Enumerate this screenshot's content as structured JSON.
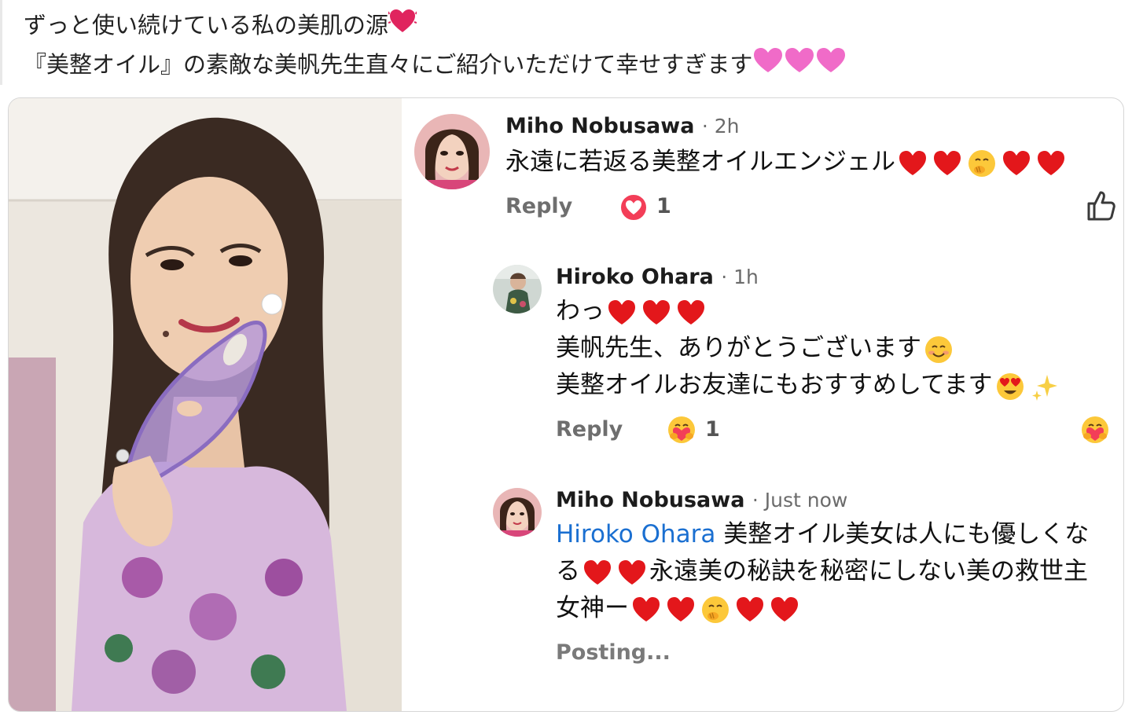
{
  "post": {
    "line1": "ずっと使い続けている私の美肌の源",
    "line2": "『美整オイル』の素敵な美帆先生直々にご紹介いただけて幸せすぎます"
  },
  "comments": [
    {
      "author": "Miho Nobusawa",
      "time": "· 2h",
      "text": "永遠に若返る美整オイルエンジェル",
      "reply_label": "Reply",
      "reaction_count": "1"
    },
    {
      "author": "Hiroko Ohara",
      "time": "· 1h",
      "line1": "わっ",
      "line2": "美帆先生、ありがとうございます",
      "line3": "美整オイルお友達にもおすすめしてます",
      "reply_label": "Reply",
      "reaction_count": "1"
    },
    {
      "author": "Miho Nobusawa",
      "time": "· Just now",
      "mention": "Hiroko Ohara",
      "line1_rest": " 美整オイル美女は人にも優しくな",
      "line2_a": "る",
      "line2_b": "永遠美の秘訣を秘密にしない美の救世主",
      "line3": "女神ー",
      "status": "Posting..."
    }
  ],
  "colors": {
    "heart": "#e3171b",
    "mention": "#1a6fd1",
    "pink_heart": "#f06bc8"
  }
}
